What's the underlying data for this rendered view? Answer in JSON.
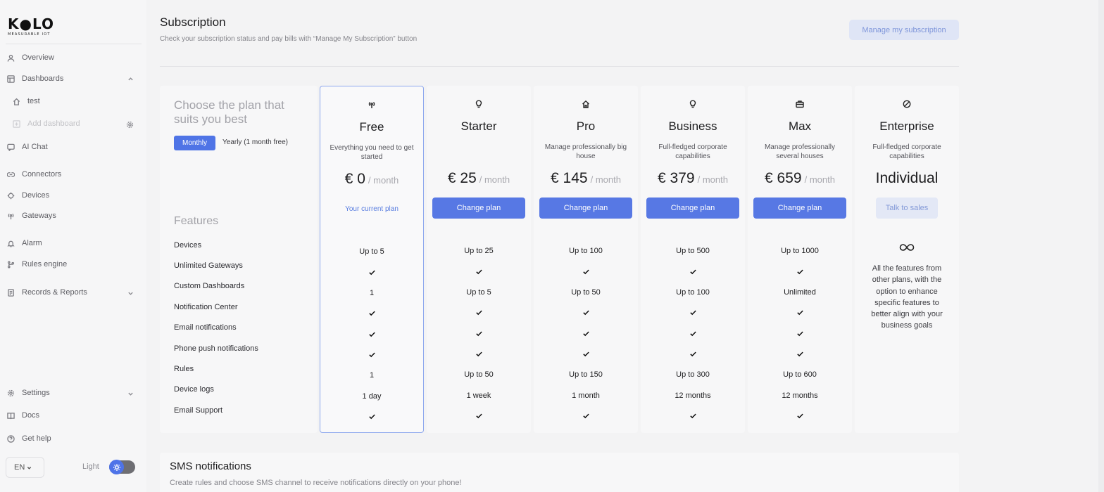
{
  "sidebar": {
    "logo": {
      "word": "K●LO",
      "tagline": "MEASURABLE IOT"
    },
    "items": [
      {
        "label": "Overview",
        "icon": "user-icon"
      },
      {
        "label": "Dashboards",
        "icon": "dashboard-icon"
      },
      {
        "label": "test",
        "icon": "home-icon"
      },
      {
        "label": "Add dashboard",
        "icon": "add-icon"
      },
      {
        "label": "AI Chat",
        "icon": "chat-icon"
      },
      {
        "label": "Connectors",
        "icon": "connector-icon"
      },
      {
        "label": "Devices",
        "icon": "chip-icon"
      },
      {
        "label": "Gateways",
        "icon": "antenna-icon"
      },
      {
        "label": "Alarm",
        "icon": "bell-icon"
      },
      {
        "label": "Rules engine",
        "icon": "flow-icon"
      },
      {
        "label": "Records & Reports",
        "icon": "report-icon"
      },
      {
        "label": "Settings",
        "icon": "gear-icon"
      },
      {
        "label": "Docs",
        "icon": "book-icon"
      },
      {
        "label": "Get help",
        "icon": "help-icon"
      }
    ],
    "language": "EN",
    "theme_label": "Light"
  },
  "header": {
    "title": "Subscription",
    "subtitle": "Check your subscription status and pay bills with “Manage My Subscription” button",
    "manage_button": "Manage my subscription"
  },
  "chooser": {
    "heading": "Choose the plan that suits you best",
    "monthly": "Monthly",
    "yearly": "Yearly (1 month free)"
  },
  "features": {
    "heading": "Features",
    "rows": [
      "Devices",
      "Unlimited Gateways",
      "Custom Dashboards",
      "Notification Center",
      "Email notifications",
      "Phone push notifications",
      "Rules",
      "Device logs",
      "Email Support"
    ]
  },
  "plans": [
    {
      "name": "Free",
      "desc": "Everything you need to get started",
      "amount": "€ 0",
      "per": "/ month",
      "button": "",
      "current_label": "Your current plan",
      "cells": [
        "Up to 5",
        "check",
        "1",
        "check",
        "check",
        "check",
        "1",
        "1 day",
        "check"
      ]
    },
    {
      "name": "Starter",
      "desc": "",
      "amount": "€ 25",
      "per": "/ month",
      "button": "Change plan",
      "current_label": "",
      "cells": [
        "Up to 25",
        "check",
        "Up to 5",
        "check",
        "check",
        "check",
        "Up to 50",
        "1 week",
        "check"
      ]
    },
    {
      "name": "Pro",
      "desc": "Manage professionally big house",
      "amount": "€ 145",
      "per": "/ month",
      "button": "Change plan",
      "current_label": "",
      "cells": [
        "Up to 100",
        "check",
        "Up to 50",
        "check",
        "check",
        "check",
        "Up to 150",
        "1 month",
        "check"
      ]
    },
    {
      "name": "Business",
      "desc": "Full-fledged corporate capabilities",
      "amount": "€ 379",
      "per": "/ month",
      "button": "Change plan",
      "current_label": "",
      "cells": [
        "Up to 500",
        "check",
        "Up to 100",
        "check",
        "check",
        "check",
        "Up to 300",
        "12 months",
        "check"
      ]
    },
    {
      "name": "Max",
      "desc": "Manage professionally several houses",
      "amount": "€ 659",
      "per": "/ month",
      "button": "Change plan",
      "current_label": "",
      "cells": [
        "Up to 1000",
        "check",
        "Unlimited",
        "check",
        "check",
        "check",
        "Up to 600",
        "12 months",
        "check"
      ]
    },
    {
      "name": "Enterprise",
      "desc": "Full-fledged corporate capabilities",
      "amount": "Individual",
      "per": "",
      "button": "Talk to sales",
      "current_label": "",
      "note": "All the features from other plans, with the option to enhance specific features to better align with your business goals"
    }
  ],
  "sms": {
    "title": "SMS notifications",
    "subtitle": "Create rules and choose SMS channel to receive notifications directly on your phone!"
  },
  "colors": {
    "accent": "#4f74e6",
    "accent_soft": "#dfe5f6",
    "current_border": "#8ea8ee"
  }
}
